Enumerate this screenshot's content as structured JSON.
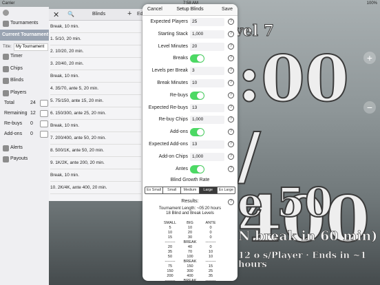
{
  "status": {
    "carrier": "Carrier",
    "time": "7:58 AM",
    "battery": "100%"
  },
  "clock": {
    "level": "vel 7",
    "time": ":00",
    "blinds": "/ 400",
    "ante": "e 50",
    "next": "N                     break in 60 min)",
    "info": "12 o                    s/Player  ·  Ends in ~1 hours"
  },
  "side_buttons": {
    "plus": "+",
    "minus": "−"
  },
  "sidebar": {
    "tournaments": "Tournaments",
    "current": "Current Tournament",
    "title_label": "Title:",
    "title_value": "My Tournament",
    "items": [
      {
        "label": "Timer",
        "icon": "timer-icon"
      },
      {
        "label": "Chips",
        "icon": "chips-icon"
      },
      {
        "label": "Blinds",
        "icon": "blinds-icon"
      },
      {
        "label": "Players",
        "icon": "players-icon"
      }
    ],
    "stats": [
      {
        "label": "Total",
        "value": "24"
      },
      {
        "label": "Remaining",
        "value": "12"
      },
      {
        "label": "Re-buys",
        "value": "0"
      },
      {
        "label": "Add-ons",
        "value": "0"
      }
    ],
    "bottom_items": [
      {
        "label": "Alerts",
        "icon": "alerts-icon"
      },
      {
        "label": "Payouts",
        "icon": "payouts-icon"
      }
    ]
  },
  "blinds_panel": {
    "close": "✕",
    "search": "🔍",
    "title": "Blinds",
    "plus": "+",
    "edit": "Ed",
    "rows": [
      "Break, 10 min.",
      "1. 5/10, 20 min.",
      "2. 10/20, 20 min.",
      "3. 20/40, 20 min.",
      "Break, 10 min.",
      "4. 35/70, ante 5, 20 min.",
      "5. 75/150, ante 15, 20 min.",
      "6. 150/300, ante 25, 20 min.",
      "Break, 10 min.",
      "7. 200/400, ante 50, 20 min.",
      "8. 500/1K, ante 50, 20 min.",
      "9. 1K/2K, ante 200, 20 min.",
      "Break, 10 min.",
      "10. 2K/4K, ante 400, 20 min."
    ]
  },
  "modal": {
    "cancel": "Cancel",
    "title": "Setup Blinds",
    "save": "Save",
    "rows": [
      {
        "label": "Expected Players",
        "value": "25",
        "type": "field"
      },
      {
        "label": "Starting Stack",
        "value": "1,000",
        "type": "field"
      },
      {
        "label": "Level Minutes",
        "value": "20",
        "type": "field"
      },
      {
        "label": "Breaks",
        "value": "on",
        "type": "toggle"
      },
      {
        "label": "Levels per Break",
        "value": "3",
        "type": "field"
      },
      {
        "label": "Break Minutes",
        "value": "10",
        "type": "field"
      },
      {
        "label": "Re-buys",
        "value": "on",
        "type": "toggle"
      },
      {
        "label": "Expected Re-buys",
        "value": "13",
        "type": "field"
      },
      {
        "label": "Re-buy Chips",
        "value": "1,000",
        "type": "field"
      },
      {
        "label": "Add-ons",
        "value": "on",
        "type": "toggle"
      },
      {
        "label": "Expected Add-ons",
        "value": "13",
        "type": "field"
      },
      {
        "label": "Add-on Chips",
        "value": "1,000",
        "type": "field"
      },
      {
        "label": "Antes",
        "value": "on",
        "type": "toggle"
      }
    ],
    "help": "?",
    "growth_label": "Blind Growth Rate",
    "growth_options": [
      "Ex Small",
      "Small",
      "Medium",
      "Large",
      "Ex Large"
    ],
    "growth_selected": "Large",
    "results_label": "Results:",
    "results_length": "Tournament Length: ~05:20 hours",
    "results_levels": "18 Blind and Break Levels",
    "results_headers": [
      "SMALL",
      "BIG",
      "ANTE"
    ],
    "results_rows": [
      [
        "5",
        "10",
        "0"
      ],
      [
        "10",
        "20",
        "0"
      ],
      [
        "15",
        "30",
        "0"
      ],
      [
        "--------",
        "BREAK",
        "--------"
      ],
      [
        "20",
        "40",
        "0"
      ],
      [
        "35",
        "70",
        "10"
      ],
      [
        "50",
        "100",
        "10"
      ],
      [
        "--------",
        "BREAK",
        "--------"
      ],
      [
        "75",
        "150",
        "15"
      ],
      [
        "150",
        "300",
        "25"
      ],
      [
        "200",
        "400",
        "35"
      ],
      [
        "--------",
        "BREAK",
        "--------"
      ]
    ]
  }
}
